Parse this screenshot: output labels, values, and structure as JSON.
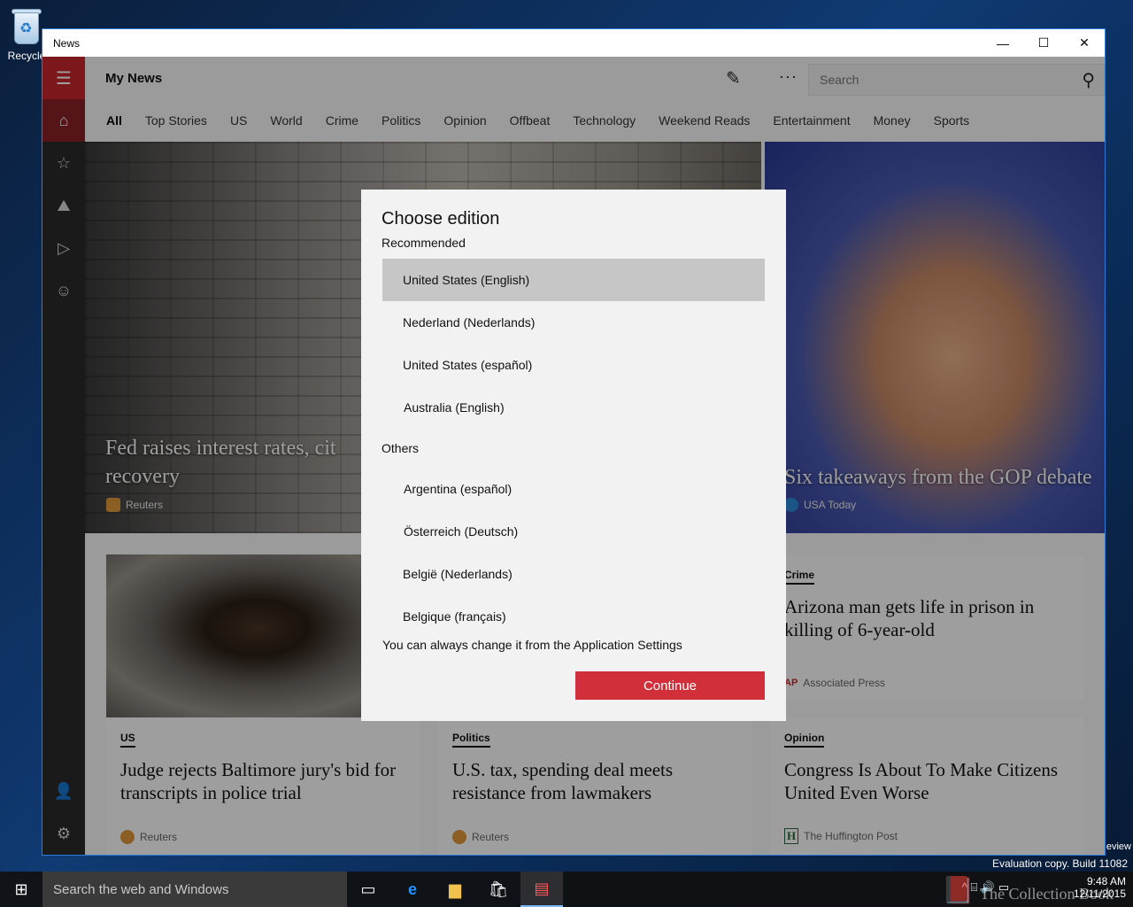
{
  "desktop": {
    "recycle_label": "Recycle"
  },
  "window": {
    "title": "News",
    "minimize": "—",
    "maximize": "☐",
    "close": "✕"
  },
  "header": {
    "title": "My News",
    "search_placeholder": "Search"
  },
  "tabs": [
    "All",
    "Top Stories",
    "US",
    "World",
    "Crime",
    "Politics",
    "Opinion",
    "Offbeat",
    "Technology",
    "Weekend Reads",
    "Entertainment",
    "Money",
    "Sports"
  ],
  "hero": {
    "left": {
      "title": "Fed raises interest rates, cit recovery",
      "line1": "Fed raises interest rates, cit",
      "line2": "recovery",
      "source": "Reuters"
    },
    "right": {
      "title": "Six takeaways from the GOP debate",
      "source": "USA Today"
    }
  },
  "cards": [
    {
      "category": "US",
      "headline": "Judge rejects Baltimore jury's bid for transcripts in police trial",
      "source": "Reuters"
    },
    {
      "category": "Politics",
      "headline": "U.S. tax, spending deal meets resistance from lawmakers",
      "source": "Reuters"
    },
    {
      "category": "Opinion",
      "headline": "Congress Is About To Make Citizens United Even Worse",
      "source": "The Huffington Post",
      "source_mark": "H"
    },
    {
      "category": "Crime",
      "headline": "Arizona man gets life in prison in killing of 6-year-old",
      "source": "Associated Press",
      "source_mark": "AP"
    }
  ],
  "dialog": {
    "title": "Choose edition",
    "recommended_label": "Recommended",
    "recommended": [
      "United States (English)",
      "Nederland (Nederlands)",
      "United States (español)",
      "Australia (English)"
    ],
    "others_label": "Others",
    "others": [
      "Argentina (español)",
      "Österreich (Deutsch)",
      "België (Nederlands)",
      "Belgique (français)"
    ],
    "note": "You can always change it from the Application Settings",
    "continue_label": "Continue"
  },
  "taskbar": {
    "search_placeholder": "Search the web and Windows",
    "time": "9:48 AM",
    "date": "12/11/2015",
    "eval_line": "Evaluation copy. Build 11082",
    "eval_prefix": "eview",
    "watermark": "The Collection Book"
  },
  "colors": {
    "accent": "#c8282e",
    "continue": "#d1303a",
    "rail": "#2b2b2b"
  }
}
